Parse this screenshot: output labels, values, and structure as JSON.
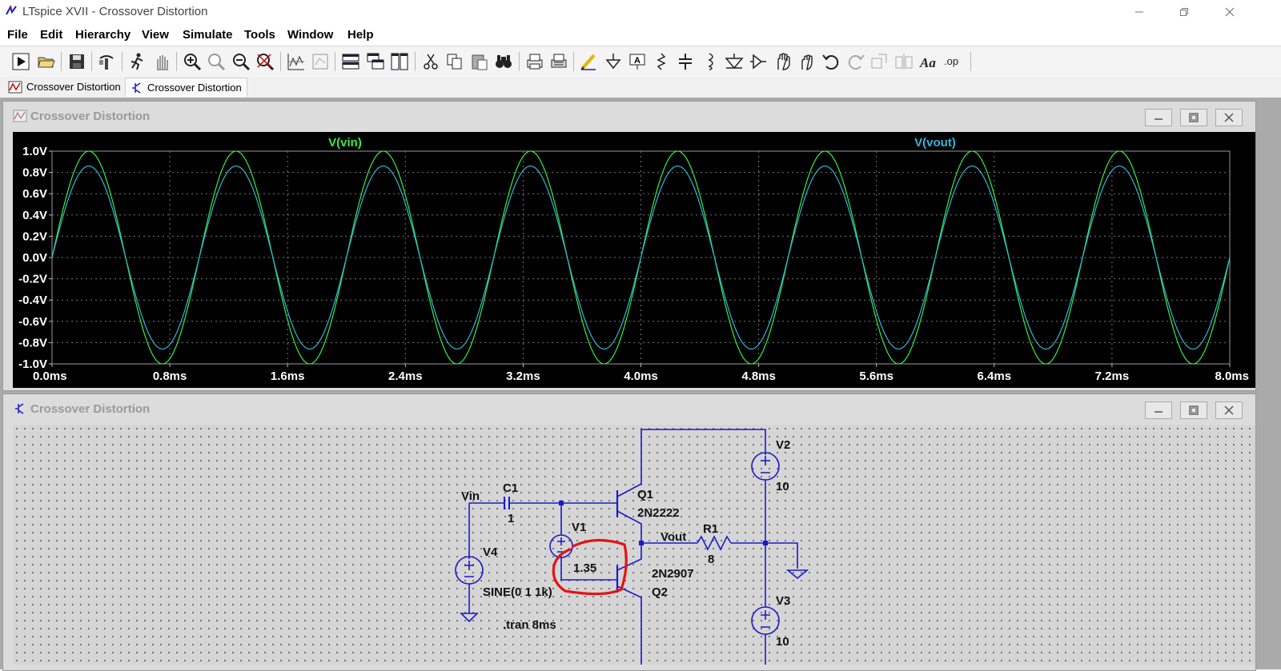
{
  "window": {
    "title": "LTspice XVII - Crossover Distortion"
  },
  "menu": [
    {
      "label": "File"
    },
    {
      "label": "Edit"
    },
    {
      "label": "Hierarchy"
    },
    {
      "label": "View"
    },
    {
      "label": "Simulate"
    },
    {
      "label": "Tools"
    },
    {
      "label": "Window"
    },
    {
      "label": "Help"
    }
  ],
  "toolbar_icons": [
    "run-icon",
    "open-icon",
    "save-icon",
    "control-panel-icon",
    "halt-icon",
    "pan-icon",
    "zoom-in-icon",
    "zoom-area-icon",
    "zoom-out-icon",
    "zoom-fit-icon",
    "autorange-icon",
    "mark-unref-icon",
    "tile-horizontal-icon",
    "cascade-icon",
    "tile-vertical-icon",
    "cut-icon",
    "copy-icon",
    "paste-icon",
    "find-icon",
    "print-icon",
    "print-setup-icon",
    "draw-wire-icon",
    "ground-icon",
    "label-net-icon",
    "resistor-icon",
    "capacitor-icon",
    "inductor-icon",
    "diode-icon",
    "component-icon",
    "move-icon",
    "drag-icon",
    "undo-icon",
    "redo-icon",
    "rotate-icon",
    "mirror-icon",
    "text-icon",
    "spice-directive-icon"
  ],
  "tabs": [
    {
      "label": "Crossover Distortion",
      "icon": "waveform-icon"
    },
    {
      "label": "Crossover Distortion",
      "icon": "schematic-icon"
    }
  ],
  "plot_window": {
    "title": "Crossover Distortion"
  },
  "schematic_window": {
    "title": "Crossover Distortion"
  },
  "chart_data": {
    "type": "line",
    "traces": [
      {
        "name": "V(vin)",
        "color": "#33ee44",
        "amplitude": 1.0,
        "frequency_hz": 1000
      },
      {
        "name": "V(vout)",
        "color": "#2fb6d8",
        "amplitude": 0.86,
        "frequency_hz": 1000
      }
    ],
    "ylim": [
      -1.0,
      1.0
    ],
    "xlim_ms": [
      0,
      8
    ],
    "y_ticks": [
      "1.0V",
      "0.8V",
      "0.6V",
      "0.4V",
      "0.2V",
      "0.0V",
      "-0.2V",
      "-0.4V",
      "-0.6V",
      "-0.8V",
      "-1.0V"
    ],
    "x_ticks": [
      "0.0ms",
      "0.8ms",
      "1.6ms",
      "2.4ms",
      "3.2ms",
      "4.0ms",
      "4.8ms",
      "5.6ms",
      "6.4ms",
      "7.2ms",
      "8.0ms"
    ],
    "grid": true,
    "background": "#000000"
  },
  "schematic": {
    "labels": {
      "vin": "Vin",
      "c1_name": "C1",
      "c1_value": "1",
      "v1_name": "V1",
      "v1_value": "1.35",
      "v4_name": "V4",
      "v4_value": "SINE(0 1 1k)",
      "q1_name": "Q1",
      "q1_model": "2N2222",
      "q2_model": "2N2907",
      "q2_name": "Q2",
      "vout": "Vout",
      "r1_name": "R1",
      "r1_value": "8",
      "v2_name": "V2",
      "v2_value": "10",
      "v3_name": "V3",
      "v3_value": "10",
      "directive": ".tran 8ms"
    },
    "wire_color": "#1a1acc",
    "annotation_color": "#e01515"
  }
}
